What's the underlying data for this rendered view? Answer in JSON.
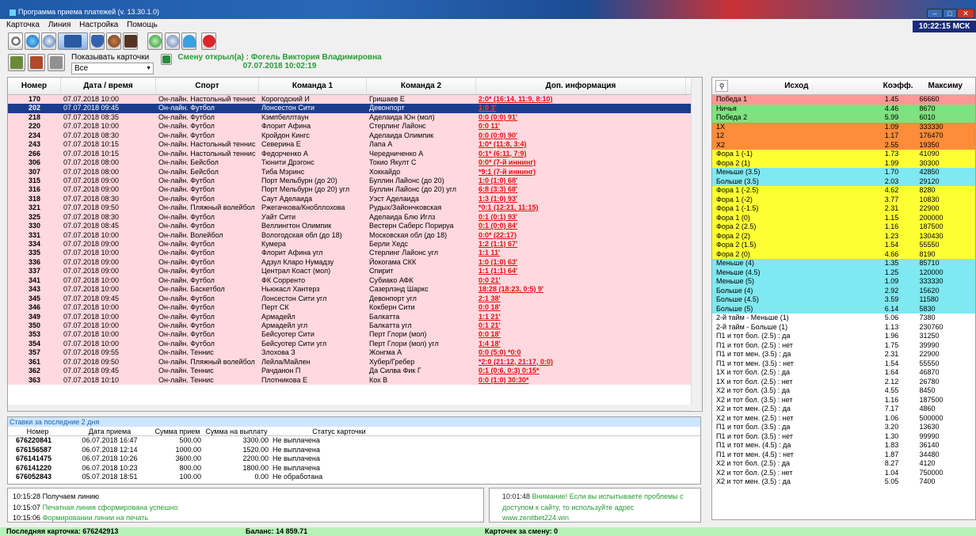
{
  "window": {
    "title": "Программа приема платежей (v. 13.30.1.0)",
    "clock": "10:22:15 МСК"
  },
  "menu": [
    "Карточка",
    "Линия",
    "Настройка",
    "Помощь"
  ],
  "toolbar": {
    "show_cards_label": "Показывать карточки",
    "filter_value": "Все",
    "shift_line1": "Смену открыл(а) : Фогель Виктория Владимировна",
    "shift_line2": "07.07.2018 10:02:19"
  },
  "grid": {
    "headers": [
      "Номер",
      "Дата / время",
      "Спорт",
      "Команда 1",
      "Команда 2",
      "Доп. информация"
    ],
    "rows": [
      [
        "170",
        "07.07.2018 10:00",
        "Он-лайн. Настольный теннис",
        "Корогодский И",
        "Гришаев Е",
        "2:0* (16:14, 11:9, 8:10)"
      ],
      [
        "202",
        "07.07.2018 09:45",
        "Он-лайн. Футбол",
        "Лонсестон Сити",
        "Девонпорт",
        "1:0 3'"
      ],
      [
        "218",
        "07.07.2018 08:35",
        "Он-лайн. Футбол",
        "Кэмпбеллтаун",
        "Аделаида Юн (мол)",
        "0:0 (0:0) 91'"
      ],
      [
        "220",
        "07.07.2018 10:00",
        "Он-лайн. Футбол",
        "Флорит Афина",
        "Стерлинг Лайонс",
        "0:0 11'"
      ],
      [
        "234",
        "07.07.2018 08:30",
        "Он-лайн. Футбол",
        "Кройдон Кингс",
        "Аделаида Олимпик",
        "0:0 (0:0) 90'"
      ],
      [
        "243",
        "07.07.2018 10:15",
        "Он-лайн. Настольный теннис",
        "Северина Е",
        "Лапа А",
        "1:0* (11:8, 3:4)"
      ],
      [
        "266",
        "07.07.2018 10:15",
        "Он-лайн. Настольный теннис",
        "Федорченко А",
        "Чередниченко А",
        "0:1* (6:11, 7:9)"
      ],
      [
        "306",
        "07.07.2018 08:00",
        "Он-лайн. Бейсбол",
        "Тюнити Дрэгонс",
        "Токио Якулт С",
        "0:0* (7-й иннинг)"
      ],
      [
        "307",
        "07.07.2018 08:00",
        "Он-лайн. Бейсбол",
        "Тиба Мэринс",
        "Хоккайдо",
        "*9:1 (7-й иннинг)"
      ],
      [
        "315",
        "07.07.2018 09:00",
        "Он-лайн. Футбол",
        "Порт Мельбурн (до 20)",
        "Буллин Лайонс (до 20)",
        "1:0 (1:0) 68'"
      ],
      [
        "316",
        "07.07.2018 09:00",
        "Он-лайн. Футбол",
        "Порт Мельбурн (до 20) угл",
        "Буллин Лайонс (до 20) угл",
        "6:8 (3:3) 68'"
      ],
      [
        "318",
        "07.07.2018 08:30",
        "Он-лайн. Футбол",
        "Саут Аделаида",
        "Уэст Аделаида",
        "1:3 (1:0) 93'"
      ],
      [
        "321",
        "07.07.2018 09:50",
        "Он-лайн. Пляжный волейбол",
        "Ржегачкова/Кнобллохова",
        "Рудых/Зайончковская",
        "*0:1 (12:21, 11:15)"
      ],
      [
        "325",
        "07.07.2018 08:30",
        "Он-лайн. Футбол",
        "Уайт Сити",
        "Аделаида Блю Иглз",
        "0:1 (0:1) 93'"
      ],
      [
        "330",
        "07.07.2018 08:45",
        "Он-лайн. Футбол",
        "Веллингтон Олимпик",
        "Вестерн Саберс Порируа",
        "0:1 (0:0) 84'"
      ],
      [
        "331",
        "07.07.2018 10:00",
        "Он-лайн. Волейбол",
        "Вологодская обл (до 18)",
        "Московская обл (до 18)",
        "0:0* (22:17)"
      ],
      [
        "334",
        "07.07.2018 09:00",
        "Он-лайн. Футбол",
        "Кумера",
        "Берли Хедс",
        "1:2 (1:1) 67'"
      ],
      [
        "335",
        "07.07.2018 10:00",
        "Он-лайн. Футбол",
        "Флорит Афина угл",
        "Стерлинг Лайонс угл",
        "1:1 11'"
      ],
      [
        "336",
        "07.07.2018 09:00",
        "Он-лайн. Футбол",
        "Адзул Кларо Нумадзу",
        "Йокогама СКК",
        "1:0 (1:0) 63'"
      ],
      [
        "337",
        "07.07.2018 09:00",
        "Он-лайн. Футбол",
        "Централ Коаст (мол)",
        "Спирит",
        "1:1 (1:1) 64'"
      ],
      [
        "341",
        "07.07.2018 10:00",
        "Он-лайн. Футбол",
        "ФК Сорренто",
        "Субиако АФК",
        "0:0 21'"
      ],
      [
        "343",
        "07.07.2018 10:00",
        "Он-лайн. Баскетбол",
        "Ньюкасл Хантерз",
        "Сазерлэнд Шаркс",
        "18:28 (18:23, 0:5) 9'"
      ],
      [
        "345",
        "07.07.2018 09:45",
        "Он-лайн. Футбол",
        "Лонсестон Сити угл",
        "Девонпорт угл",
        "2:1 38'"
      ],
      [
        "346",
        "07.07.2018 10:00",
        "Он-лайн. Футбол",
        "Перт СК",
        "Кокберн Сити",
        "0:0 18'"
      ],
      [
        "349",
        "07.07.2018 10:00",
        "Он-лайн. Футбол",
        "Армадейл",
        "Балкатта",
        "1:1 21'"
      ],
      [
        "350",
        "07.07.2018 10:00",
        "Он-лайн. Футбол",
        "Армадейл угл",
        "Балкатта угл",
        "0:1 21'"
      ],
      [
        "353",
        "07.07.2018 10:00",
        "Он-лайн. Футбол",
        "Бейсуотер Сити",
        "Перт Глори (мол)",
        "0:0 18'"
      ],
      [
        "354",
        "07.07.2018 10:00",
        "Он-лайн. Футбол",
        "Бейсуотер Сити угл",
        "Перт Глори (мол) угл",
        "1:4 18'"
      ],
      [
        "357",
        "07.07.2018 09:55",
        "Он-лайн. Теннис",
        "Злохова З",
        "Жонгма А",
        "0:0 (5:0) *0:0"
      ],
      [
        "361",
        "07.07.2018 09:50",
        "Он-лайн. Пляжный волейбол",
        "Лейла/Майлен",
        "Хубер/Гребер",
        "*2:0 (21:12, 21:17, 0:0)"
      ],
      [
        "362",
        "07.07.2018 09:45",
        "Он-лайн. Теннис",
        "Рачданон П",
        "Да Силва Фик Г",
        "0:1 (0:6, 0:3) 0:15*"
      ],
      [
        "363",
        "07.07.2018 10:10",
        "Он-лайн. Теннис",
        "Плотникова Е",
        "Кох В",
        "0:0 (1:0) 30:30*"
      ]
    ]
  },
  "bets": {
    "title": "Ставки за последние 2 дня",
    "headers": [
      "Номер",
      "Дата приема",
      "Сумма прием",
      "Сумма на выплату",
      "Статус карточки"
    ],
    "rows": [
      [
        "676220841",
        "06.07.2018 16:47",
        "500.00",
        "3300.00",
        "Не выплачена"
      ],
      [
        "676156587",
        "06.07.2018 12:14",
        "1000.00",
        "1520.00",
        "Не выплачена"
      ],
      [
        "676141475",
        "06.07.2018 10:26",
        "3600.00",
        "2200.00",
        "Не выплачена"
      ],
      [
        "676141220",
        "06.07.2018 10:23",
        "800.00",
        "1800.00",
        "Не выплачена"
      ],
      [
        "676052843",
        "05.07.2018 18:51",
        "100.00",
        "0.00",
        "Не обработана"
      ]
    ]
  },
  "log": [
    {
      "time": "10:15:28",
      "text": "Получаем линию"
    },
    {
      "time": "10:15:07",
      "text": "Печатная линия сформирована успешно"
    },
    {
      "time": "10:15:06",
      "text": "Формировании линии на печать"
    }
  ],
  "notice": {
    "time": "10:01:48",
    "warn": "Внимание! Если вы испытываете проблемы с",
    "line2": "доступом к сайту, то используйте адрес",
    "url": "www.zenitbet224.win"
  },
  "outcomes": {
    "headers": [
      "Исход",
      "Коэфф.",
      "Максиму"
    ],
    "rows": [
      [
        "Победа 1",
        "1.45",
        "66660",
        "#ff9797"
      ],
      [
        "Ничья",
        "4.46",
        "8670",
        "#7fe17f"
      ],
      [
        "Победа 2",
        "5.99",
        "6010",
        "#7fe17f"
      ],
      [
        "1X",
        "1.09",
        "333330",
        "#ff8c3a"
      ],
      [
        "12",
        "1.17",
        "176470",
        "#ff8c3a"
      ],
      [
        "X2",
        "2.55",
        "19350",
        "#ff8c3a"
      ],
      [
        "Фора 1 (-1)",
        "1.73",
        "41090",
        "#ffff33"
      ],
      [
        "Фора 2 (1)",
        "1.99",
        "30300",
        "#ffff33"
      ],
      [
        "Меньше (3.5)",
        "1.70",
        "42850",
        "#7fe8f0"
      ],
      [
        "Больше (3.5)",
        "2.03",
        "29120",
        "#7fe8f0"
      ],
      [
        "Фора 1 (-2.5)",
        "4.62",
        "8280",
        "#ffff33"
      ],
      [
        "Фора 1 (-2)",
        "3.77",
        "10830",
        "#ffff33"
      ],
      [
        "Фора 1 (-1.5)",
        "2.31",
        "22900",
        "#ffff33"
      ],
      [
        "Фора 1 (0)",
        "1.15",
        "200000",
        "#ffff33"
      ],
      [
        "Фора 2 (2.5)",
        "1.16",
        "187500",
        "#ffff33"
      ],
      [
        "Фора 2 (2)",
        "1.23",
        "130430",
        "#ffff33"
      ],
      [
        "Фора 2 (1.5)",
        "1.54",
        "55550",
        "#ffff33"
      ],
      [
        "Фора 2 (0)",
        "4.66",
        "8190",
        "#ffff33"
      ],
      [
        "Меньше (4)",
        "1.35",
        "85710",
        "#7fe8f0"
      ],
      [
        "Меньше (4.5)",
        "1.25",
        "120000",
        "#7fe8f0"
      ],
      [
        "Меньше (5)",
        "1.09",
        "333330",
        "#7fe8f0"
      ],
      [
        "Больше (4)",
        "2.92",
        "15620",
        "#7fe8f0"
      ],
      [
        "Больше (4.5)",
        "3.59",
        "11580",
        "#7fe8f0"
      ],
      [
        "Больше (5)",
        "6.14",
        "5830",
        "#7fe8f0"
      ],
      [
        "2-й тайм - Меньше (1)",
        "5.06",
        "7380",
        ""
      ],
      [
        "2-й тайм - Больше (1)",
        "1.13",
        "230760",
        ""
      ],
      [
        "П1 и тот бол. (2.5) : да",
        "1.96",
        "31250",
        ""
      ],
      [
        "П1 и тот бол. (2.5) : нет",
        "1.75",
        "39990",
        ""
      ],
      [
        "П1 и тот мен. (3.5) : да",
        "2.31",
        "22900",
        ""
      ],
      [
        "П1 и тот мен. (3.5) : нет",
        "1.54",
        "55550",
        ""
      ],
      [
        "1X и тот бол. (2.5) : да",
        "1.64",
        "46870",
        ""
      ],
      [
        "1X и тот бол. (2.5) : нет",
        "2.12",
        "26780",
        ""
      ],
      [
        "X2 и тот бол. (3.5) : да",
        "4.55",
        "8450",
        ""
      ],
      [
        "X2 и тот бол. (3.5) : нет",
        "1.16",
        "187500",
        ""
      ],
      [
        "X2 и тот мен. (2.5) : да",
        "7.17",
        "4860",
        ""
      ],
      [
        "X2 и тот мен. (2.5) : нет",
        "1.06",
        "500000",
        ""
      ],
      [
        "П1 и тот бол. (3.5) : да",
        "3.20",
        "13630",
        ""
      ],
      [
        "П1 и тот бол. (3.5) : нет",
        "1.30",
        "99990",
        ""
      ],
      [
        "П1 и тот мен. (4.5) : да",
        "1.83",
        "36140",
        ""
      ],
      [
        "П1 и тот мен. (4.5) : нет",
        "1.87",
        "34480",
        ""
      ],
      [
        "X2 и тот бол. (2.5) : да",
        "8.27",
        "4120",
        ""
      ],
      [
        "X2 и тот бол. (2.5) : нет",
        "1.04",
        "750000",
        ""
      ],
      [
        "X2 и тот мен. (3.5) : да",
        "5.05",
        "7400",
        ""
      ]
    ]
  },
  "status": {
    "last_card": "Последняя карточка: 676242913",
    "balance": "Баланс: 14 859.71",
    "cards_shift": "Карточек за смену: 0"
  }
}
